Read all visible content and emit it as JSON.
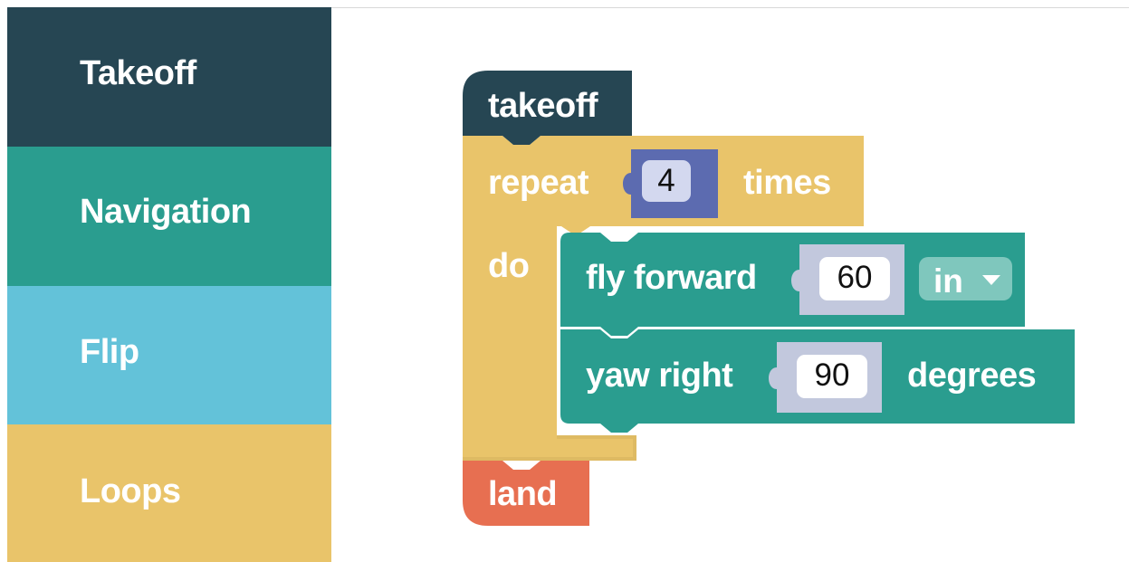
{
  "sidebar": {
    "categories": [
      {
        "label": "Takeoff",
        "color": "#264653"
      },
      {
        "label": "Navigation",
        "color": "#2a9d8f"
      },
      {
        "label": "Flip",
        "color": "#63c2d9"
      },
      {
        "label": "Loops",
        "color": "#e9c46a"
      }
    ]
  },
  "workspace": {
    "takeoff_block": {
      "label": "takeoff",
      "color": "#264653"
    },
    "repeat_block": {
      "label": "repeat",
      "count": "4",
      "suffix": "times",
      "do_label": "do",
      "color": "#e9c46a",
      "number_color": "#5c6bb0"
    },
    "fly_forward_block": {
      "label": "fly forward",
      "distance": "60",
      "unit": "in",
      "color": "#2a9d8f",
      "socket_color": "#c2c8dd"
    },
    "yaw_right_block": {
      "label": "yaw right",
      "angle": "90",
      "suffix": "degrees",
      "color": "#2a9d8f"
    },
    "land_block": {
      "label": "land",
      "color": "#e76f51"
    }
  }
}
